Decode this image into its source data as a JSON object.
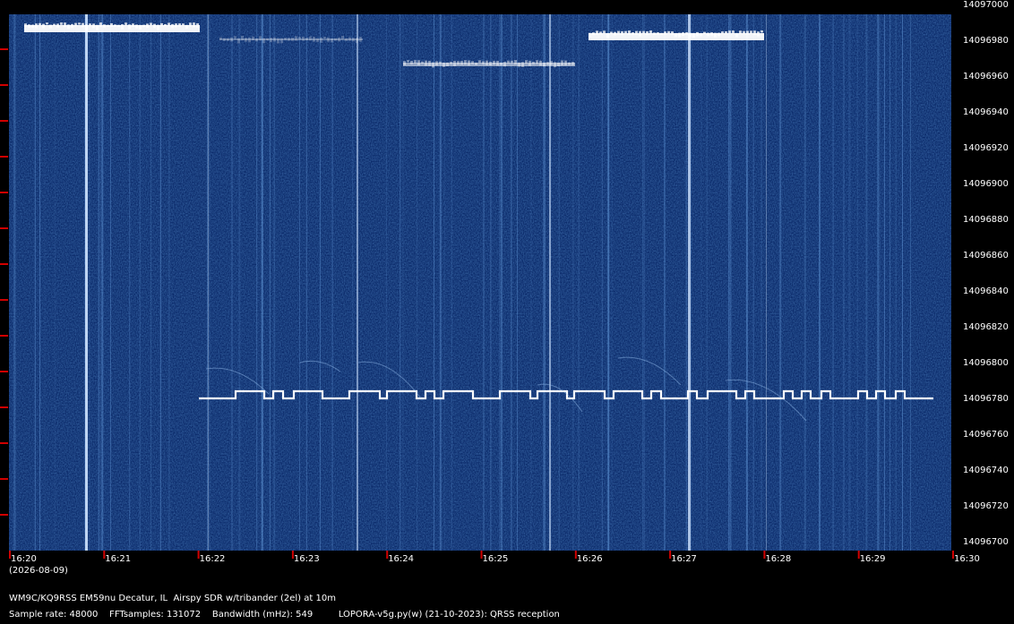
{
  "colors": {
    "background": "#000000",
    "waterfall_base": "#0b2a6a",
    "signal": "#ffffff",
    "tick": "#d00000"
  },
  "frequency_axis": {
    "labels": [
      "14097000",
      "14096980",
      "14096960",
      "14096940",
      "14096920",
      "14096900",
      "14096880",
      "14096860",
      "14096840",
      "14096820",
      "14096800",
      "14096780",
      "14096760",
      "14096740",
      "14096720",
      "14096700"
    ],
    "top_value": 14097000,
    "bottom_value": 14096700
  },
  "time_axis": {
    "labels": [
      "16:20",
      "16:21",
      "16:22",
      "16:23",
      "16:24",
      "16:25",
      "16:26",
      "16:27",
      "16:28",
      "16:29",
      "16:30"
    ],
    "date": "(2026-08-09)"
  },
  "footer": {
    "station": "WM9C/KQ9RSS EM59nu Decatur, IL  Airspy SDR w/tribander (2el) at 10m",
    "info": "Sample rate: 48000    FFTsamples: 131072    Bandwidth (mHz): 549         LOPORA-v5g.py(w) (21-10-2023): QRSS reception"
  }
}
